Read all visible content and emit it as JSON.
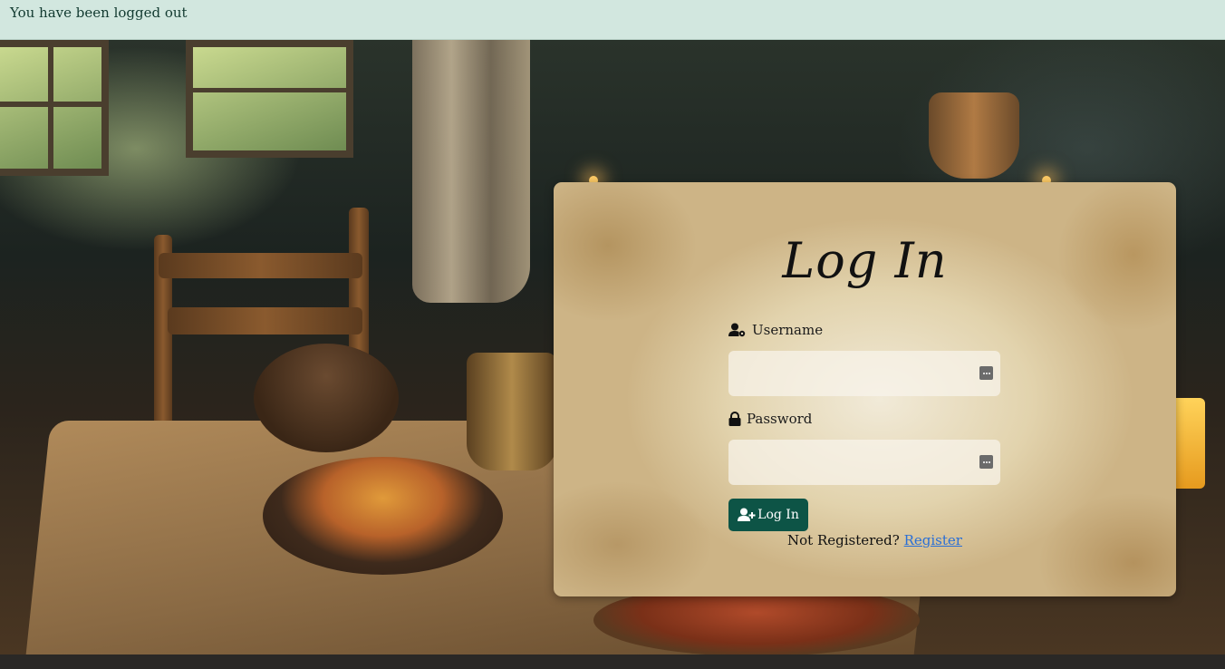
{
  "alert": {
    "message": "You have been logged out"
  },
  "login": {
    "title": "Log In",
    "username_label": "Username",
    "password_label": "Password",
    "username_value": "",
    "password_value": "",
    "submit_label": "Log In",
    "not_registered_text": "Not Registered?",
    "register_link": "Register"
  },
  "colors": {
    "alert_bg": "#d2e7df",
    "button_bg": "#0d5446",
    "link": "#2a6fd6"
  },
  "icons": {
    "username": "user-gear-icon",
    "password": "lock-icon",
    "submit": "user-plus-icon",
    "input_autofill": "password-manager-icon"
  }
}
